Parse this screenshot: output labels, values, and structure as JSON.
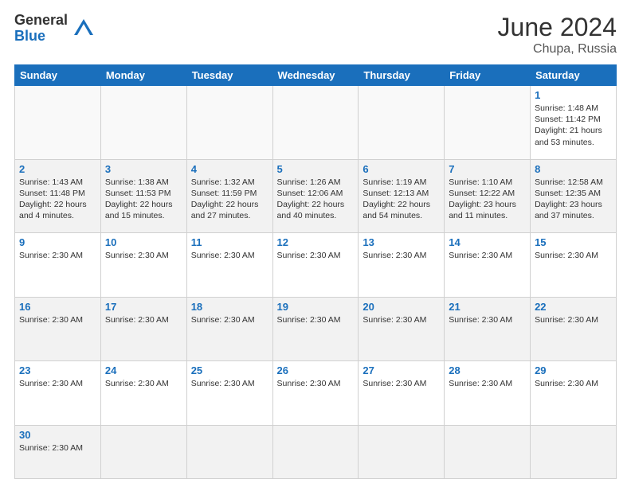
{
  "logo": {
    "general": "General",
    "blue": "Blue"
  },
  "title": {
    "month_year": "June 2024",
    "location": "Chupa, Russia"
  },
  "header_days": [
    "Sunday",
    "Monday",
    "Tuesday",
    "Wednesday",
    "Thursday",
    "Friday",
    "Saturday"
  ],
  "weeks": [
    {
      "alt": false,
      "days": [
        {
          "num": "",
          "info": ""
        },
        {
          "num": "",
          "info": ""
        },
        {
          "num": "",
          "info": ""
        },
        {
          "num": "",
          "info": ""
        },
        {
          "num": "",
          "info": ""
        },
        {
          "num": "",
          "info": ""
        },
        {
          "num": "1",
          "info": "Sunrise: 1:48 AM\nSunset: 11:42 PM\nDaylight: 21 hours and 53 minutes."
        }
      ]
    },
    {
      "alt": true,
      "days": [
        {
          "num": "2",
          "info": "Sunrise: 1:43 AM\nSunset: 11:48 PM\nDaylight: 22 hours and 4 minutes."
        },
        {
          "num": "3",
          "info": "Sunrise: 1:38 AM\nSunset: 11:53 PM\nDaylight: 22 hours and 15 minutes."
        },
        {
          "num": "4",
          "info": "Sunrise: 1:32 AM\nSunset: 11:59 PM\nDaylight: 22 hours and 27 minutes."
        },
        {
          "num": "5",
          "info": "Sunrise: 1:26 AM\nSunset: 12:06 AM\nDaylight: 22 hours and 40 minutes."
        },
        {
          "num": "6",
          "info": "Sunrise: 1:19 AM\nSunset: 12:13 AM\nDaylight: 22 hours and 54 minutes."
        },
        {
          "num": "7",
          "info": "Sunrise: 1:10 AM\nSunset: 12:22 AM\nDaylight: 23 hours and 11 minutes."
        },
        {
          "num": "8",
          "info": "Sunrise: 12:58 AM\nSunset: 12:35 AM\nDaylight: 23 hours and 37 minutes."
        }
      ]
    },
    {
      "alt": false,
      "days": [
        {
          "num": "9",
          "info": "Sunrise: 2:30 AM"
        },
        {
          "num": "10",
          "info": "Sunrise: 2:30 AM"
        },
        {
          "num": "11",
          "info": "Sunrise: 2:30 AM"
        },
        {
          "num": "12",
          "info": "Sunrise: 2:30 AM"
        },
        {
          "num": "13",
          "info": "Sunrise: 2:30 AM"
        },
        {
          "num": "14",
          "info": "Sunrise: 2:30 AM"
        },
        {
          "num": "15",
          "info": "Sunrise: 2:30 AM"
        }
      ]
    },
    {
      "alt": true,
      "days": [
        {
          "num": "16",
          "info": "Sunrise: 2:30 AM"
        },
        {
          "num": "17",
          "info": "Sunrise: 2:30 AM"
        },
        {
          "num": "18",
          "info": "Sunrise: 2:30 AM"
        },
        {
          "num": "19",
          "info": "Sunrise: 2:30 AM"
        },
        {
          "num": "20",
          "info": "Sunrise: 2:30 AM"
        },
        {
          "num": "21",
          "info": "Sunrise: 2:30 AM"
        },
        {
          "num": "22",
          "info": "Sunrise: 2:30 AM"
        }
      ]
    },
    {
      "alt": false,
      "days": [
        {
          "num": "23",
          "info": "Sunrise: 2:30 AM"
        },
        {
          "num": "24",
          "info": "Sunrise: 2:30 AM"
        },
        {
          "num": "25",
          "info": "Sunrise: 2:30 AM"
        },
        {
          "num": "26",
          "info": "Sunrise: 2:30 AM"
        },
        {
          "num": "27",
          "info": "Sunrise: 2:30 AM"
        },
        {
          "num": "28",
          "info": "Sunrise: 2:30 AM"
        },
        {
          "num": "29",
          "info": "Sunrise: 2:30 AM"
        }
      ]
    },
    {
      "alt": true,
      "last": true,
      "days": [
        {
          "num": "30",
          "info": "Sunrise: 2:30 AM"
        },
        {
          "num": "",
          "info": ""
        },
        {
          "num": "",
          "info": ""
        },
        {
          "num": "",
          "info": ""
        },
        {
          "num": "",
          "info": ""
        },
        {
          "num": "",
          "info": ""
        },
        {
          "num": "",
          "info": ""
        }
      ]
    }
  ]
}
